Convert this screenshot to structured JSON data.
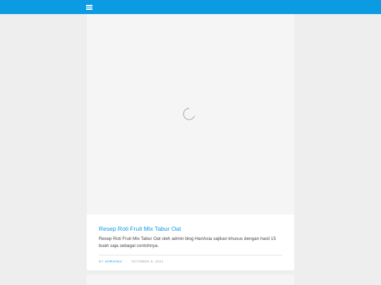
{
  "header": {
    "menu_icon": "hamburger-menu-icon",
    "color": "#0b9be3"
  },
  "post": {
    "thumbnail_state": "loading-spinner",
    "title": "Resep Roti Fruit Mix Tabur Oat",
    "excerpt": "Resep Roti Fruit Mix Tabur Oat oleh admin blog HariAsia sajikan khusus dengan hasil 15 buah saja sebagai contohnya.",
    "meta": {
      "by_label": "BY",
      "author": "HARIASIA",
      "separator": "-",
      "date": "OCTOBER 5, 2021"
    }
  }
}
